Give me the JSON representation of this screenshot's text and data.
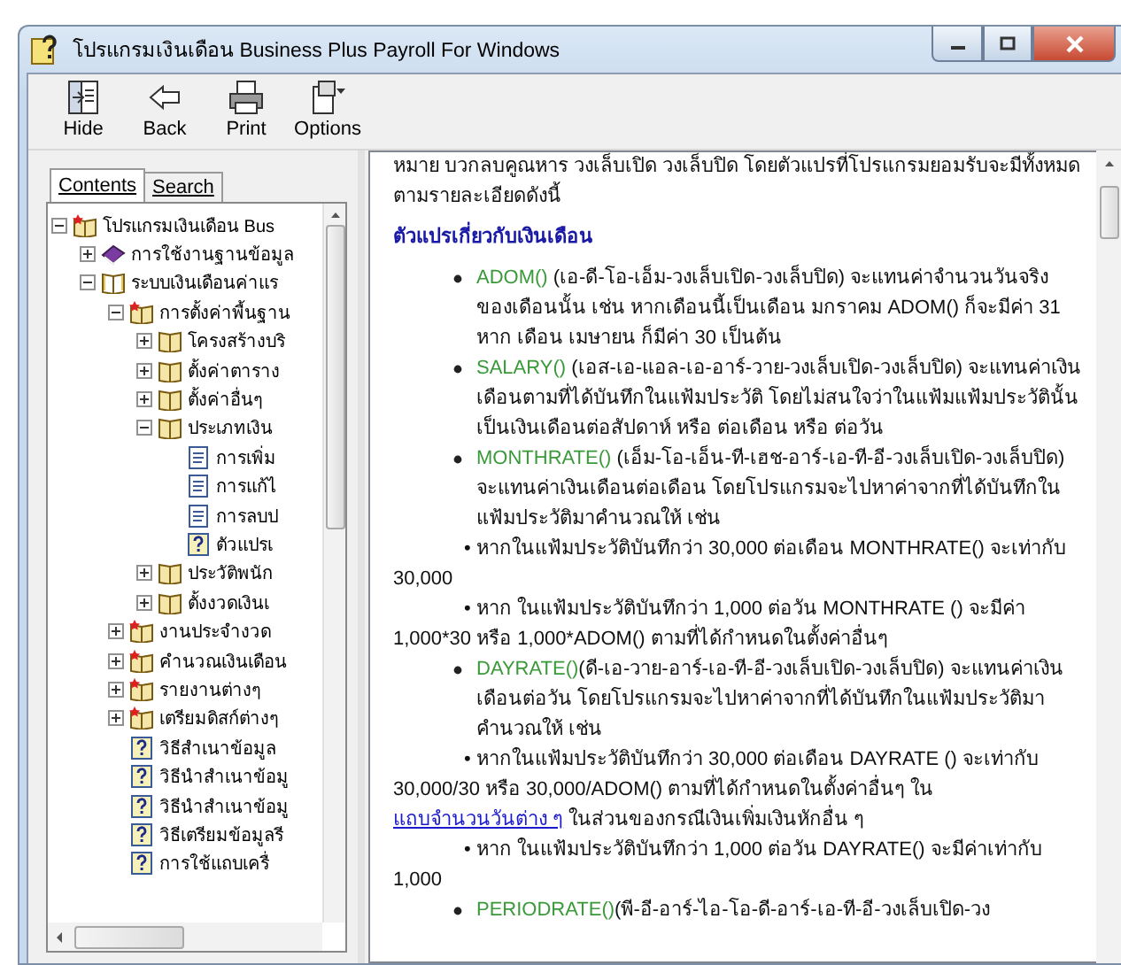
{
  "window": {
    "title": "โปรแกรมเงินเดือน Business Plus Payroll For Windows"
  },
  "toolbar": [
    {
      "kind": "hide",
      "label": "Hide"
    },
    {
      "kind": "back",
      "label": "Back"
    },
    {
      "kind": "print",
      "label": "Print"
    },
    {
      "kind": "options",
      "label": "Options"
    }
  ],
  "tabs": [
    {
      "label": "Contents",
      "selected": true
    },
    {
      "label": "Search",
      "selected": false
    }
  ],
  "tree": [
    {
      "kind": "book_star",
      "label": "โปรแกรมเงินเดือน Bus",
      "expanded": true,
      "children": [
        {
          "kind": "book_purple",
          "label": "การใช้งานฐานข้อมูล",
          "expanded": false
        },
        {
          "kind": "book_open",
          "label": "ระบบเงินเดือนค่าแร",
          "expanded": true,
          "children": [
            {
              "kind": "book_star",
              "label": "การตั้งค่าพื้นฐาน",
              "expanded": true,
              "children": [
                {
                  "kind": "book",
                  "label": "โครงสร้างบริ",
                  "expanded": false
                },
                {
                  "kind": "book",
                  "label": "ตั้งค่าตาราง",
                  "expanded": false
                },
                {
                  "kind": "book",
                  "label": "ตั้งค่าอื่นๆ",
                  "expanded": false
                },
                {
                  "kind": "book",
                  "label": "ประเภทเงิน",
                  "expanded": true,
                  "children": [
                    {
                      "kind": "page",
                      "label": "การเพิ่ม"
                    },
                    {
                      "kind": "page",
                      "label": "การแก้ไ"
                    },
                    {
                      "kind": "page",
                      "label": "การลบป"
                    },
                    {
                      "kind": "help",
                      "label": "ตัวแปรเ"
                    }
                  ]
                },
                {
                  "kind": "book",
                  "label": "ประวัติพนัก",
                  "expanded": false
                },
                {
                  "kind": "book",
                  "label": "ตั้งงวดเงินเ",
                  "expanded": false
                }
              ]
            },
            {
              "kind": "book_star",
              "label": "งานประจำงวด",
              "expanded": false
            },
            {
              "kind": "book_star",
              "label": "คำนวณเงินเดือน",
              "expanded": false
            },
            {
              "kind": "book_star",
              "label": "รายงานต่างๆ",
              "expanded": false
            },
            {
              "kind": "book_star",
              "label": "เตรียมดิสก์ต่างๆ",
              "expanded": false
            },
            {
              "kind": "help",
              "label": "วิธีสำเนาข้อมูล"
            },
            {
              "kind": "help",
              "label": "วิธีนำสำเนาข้อมู"
            },
            {
              "kind": "help",
              "label": "วิธีนำสำเนาข้อมู"
            },
            {
              "kind": "help",
              "label": "วิธีเตรียมข้อมูลรี"
            },
            {
              "kind": "help",
              "label": "การใช้แถบเครื่"
            }
          ]
        }
      ]
    }
  ],
  "content": [
    {
      "kind": "paragraph",
      "text": "หมาย บวกลบคูณหาร วงเล็บเปิด วงเล็บปิด โดยตัวแปรที่โปรแกรมยอมรับจะมีทั้งหมด ตามรายละเอียดดังนี้"
    },
    {
      "kind": "heading",
      "text": "ตัวแปรเกี่ยวกับเงินเดือน"
    },
    {
      "kind": "bullet",
      "term": "ADOM()",
      "text": " (เอ-ดี-โอ-เอ็ม-วงเล็บเปิด-วงเล็บปิด) จะแทนค่าจำนวนวันจริงของเดือนนั้น เช่น หากเดือนนี้เป็นเดือน มกราคม ADOM() ก็จะมีค่า 31 หาก เดือน เมษายน ก็มีค่า 30 เป็นต้น"
    },
    {
      "kind": "bullet",
      "term": "SALARY()",
      "text": " (เอส-เอ-แอล-เอ-อาร์-วาย-วงเล็บเปิด-วงเล็บปิด) จะแทนค่าเงินเดือนตามที่ได้บันทึกในแฟ้มประวัติ โดยไม่สนใจว่าในแฟ้มแฟ้มประวัตินั้นเป็นเงินเดือนต่อสัปดาห์ หรือ ต่อเดือน หรือ ต่อวัน"
    },
    {
      "kind": "bullet",
      "term": "MONTHRATE()",
      "text": " (เอ็ม-โอ-เอ็น-ที-เฮช-อาร์-เอ-ที-อี-วงเล็บเปิด-วงเล็บปิด) จะแทนค่าเงินเดือนต่อเดือน โดยโปรแกรมจะไปหาค่าจากที่ได้บันทึกในแฟ้มประวัติมาคำนวณให้ เช่น",
      "subs": [
        {
          "text": "• หากในแฟ้มประวัติบันทึกว่า 30,000 ต่อเดือน MONTHRATE() จะเท่ากับ 30,000"
        },
        {
          "text": "• หาก ในแฟ้มประวัติบันทึกว่า 1,000 ต่อวัน MONTHRATE () จะมีค่า 1,000*30 หรือ 1,000*ADOM() ตามที่ได้กำหนดในตั้งค่าอื่นๆ"
        }
      ]
    },
    {
      "kind": "bullet",
      "term": "DAYRATE()",
      "text": "(ดี-เอ-วาย-อาร์-เอ-ที-อี-วงเล็บเปิด-วงเล็บปิด) จะแทนค่าเงินเดือนต่อวัน โดยโปรแกรมจะไปหาค่าจากที่ได้บันทึกในแฟ้มประวัติมาคำนวณให้ เช่น",
      "subs": [
        {
          "text": "• หากในแฟ้มประวัติบันทึกว่า 30,000 ต่อเดือน DAYRATE () จะเท่ากับ 30,000/30 หรือ 30,000/ADOM() ตามที่ได้กำหนดในตั้งค่าอื่นๆ ใน",
          "link": "แถบจำนวนวันต่าง ๆ",
          "after": " ในส่วนของกรณีเงินเพิ่มเงินหักอื่น ๆ"
        },
        {
          "text": "• หาก ในแฟ้มประวัติบันทึกว่า 1,000 ต่อวัน DAYRATE() จะมีค่าเท่ากับ 1,000"
        }
      ]
    },
    {
      "kind": "bullet",
      "term": "PERIODRATE()",
      "text": "(พี-อี-อาร์-ไอ-โอ-ดี-อาร์-เอ-ที-อี-วงเล็บเปิด-วง"
    }
  ]
}
